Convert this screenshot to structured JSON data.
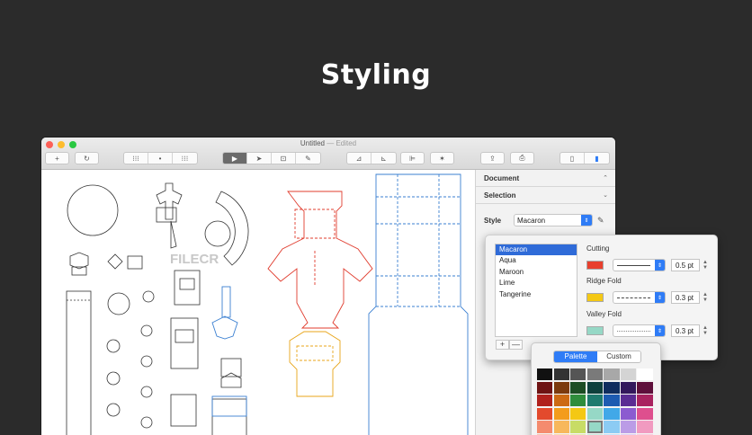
{
  "headline": "Styling",
  "window": {
    "title": "Untitled",
    "title_suffix": "— Edited"
  },
  "toolbar": {
    "add_icon": "+",
    "sync_icon": "↻",
    "view_icons": [
      "⁝⁝⁝",
      "•",
      "⁝⁝⁝"
    ],
    "tool_icons": [
      "▶",
      "➤",
      "⊡",
      "✎"
    ],
    "arrange_icons": [
      "⊿",
      "⊾",
      "⊫",
      "✶"
    ],
    "share_icon": "⇪",
    "print_icon": "⎙"
  },
  "inspector": {
    "document_label": "Document",
    "selection_label": "Selection",
    "style_label": "Style",
    "style_value": "Macaron",
    "chevron_up": "⌃",
    "chevron_down": "⌄"
  },
  "style_editor": {
    "styles": [
      "Macaron",
      "Aqua",
      "Maroon",
      "Lime",
      "Tangerine"
    ],
    "selected_style": "Macaron",
    "add_label": "+",
    "remove_label": "—",
    "cutting": {
      "label": "Cutting",
      "color": "#e8402e",
      "width": "0.5 pt"
    },
    "ridge_fold": {
      "label": "Ridge Fold",
      "color": "#f4c814",
      "width": "0.3 pt"
    },
    "valley_fold": {
      "label": "Valley Fold",
      "color": "#96d8c6",
      "width": "0.3 pt"
    }
  },
  "color_panel": {
    "tabs": [
      "Palette",
      "Custom"
    ],
    "active_tab": "Palette",
    "picked_color": "#96d8c6",
    "palette": [
      "#111111",
      "#333333",
      "#555555",
      "#7a7a7a",
      "#a8a8a8",
      "#d4d4d4",
      "#ffffff",
      "#6e1313",
      "#7c3a0e",
      "#1d4d24",
      "#0e3f3c",
      "#102d5e",
      "#33185c",
      "#5e0f3b",
      "#b0211d",
      "#cc6a14",
      "#2f8d3c",
      "#1f7a6f",
      "#1d5bb1",
      "#5a2c93",
      "#a8235f",
      "#e34a2d",
      "#f39c1c",
      "#f4c814",
      "#96d8c6",
      "#41a8e8",
      "#8c5bd0",
      "#de4f8e",
      "#f48b6e",
      "#f7b85c",
      "#c8dc66",
      "#96d8c6",
      "#8ccbf3",
      "#bb9ce6",
      "#f19ac0",
      "#fbc6b4",
      "#fbdcaa",
      "#e5eeb3",
      "#c9ecdf",
      "#c6e5fb",
      "#dfd0f5",
      "#f8cde0"
    ]
  },
  "watermark": "FILECR"
}
